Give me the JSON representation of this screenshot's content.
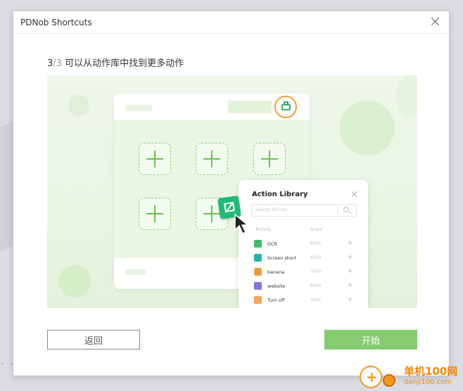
{
  "window": {
    "title": "PDNob Shortcuts"
  },
  "step": {
    "current": "3",
    "separator": "/",
    "total": "3",
    "text": " 可以从动作库中找到更多动作"
  },
  "illustration": {
    "panel_title": "Action Library",
    "search_placeholder": "Search Activity",
    "col_activity": "Activity",
    "col_share": "Share",
    "rows": [
      {
        "name": "OCR",
        "share": "6902",
        "color": "#3fbf6b"
      },
      {
        "name": "Screen short",
        "share": "8029",
        "color": "#1fb3a8"
      },
      {
        "name": "banana",
        "share": "7630",
        "color": "#f39a3a"
      },
      {
        "name": "website",
        "share": "6930",
        "color": "#8a6fe0"
      },
      {
        "name": "Turn off",
        "share": "4021",
        "color": "#f1a95a"
      }
    ],
    "plus_glyph": "+"
  },
  "buttons": {
    "back": "返回",
    "start": "开始"
  },
  "background": {
    "dash_text": "- -"
  },
  "watermark": {
    "name": "单机100网",
    "url": "danji100.com"
  }
}
